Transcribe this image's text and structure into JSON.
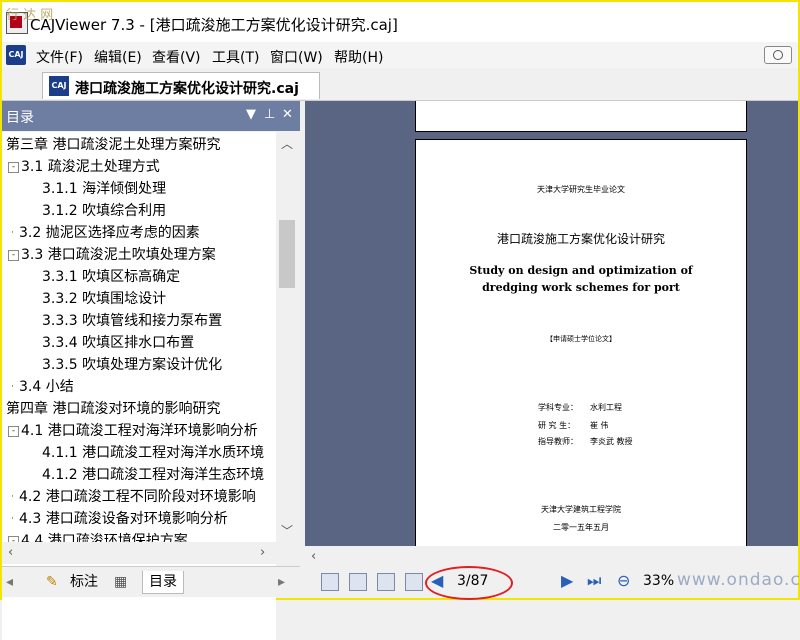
{
  "window": {
    "title": "CAJViewer 7.3 - [港口疏浚施工方案优化设计研究.caj]",
    "watermark": "行 达 网"
  },
  "menu": [
    "文件(F)",
    "编辑(E)",
    "查看(V)",
    "工具(T)",
    "窗口(W)",
    "帮助(H)"
  ],
  "doc_tab": {
    "label": "港口疏浚施工方案优化设计研究.caj"
  },
  "toc": {
    "header": "目录",
    "items": [
      {
        "label": "第三章 港口疏浚泥土处理方案研究",
        "level": 0,
        "box": ""
      },
      {
        "label": "3.1 疏浚泥土处理方式",
        "level": 1,
        "box": "-"
      },
      {
        "label": "3.1.1 海洋倾倒处理",
        "level": 2,
        "box": ""
      },
      {
        "label": "3.1.2 吹填综合利用",
        "level": 2,
        "box": ""
      },
      {
        "label": "3.2 抛泥区选择应考虑的因素",
        "level": 1,
        "box": ""
      },
      {
        "label": "3.3 港口疏浚泥土吹填处理方案",
        "level": 1,
        "box": "-"
      },
      {
        "label": "3.3.1 吹填区标高确定",
        "level": 2,
        "box": ""
      },
      {
        "label": "3.3.2 吹填围埝设计",
        "level": 2,
        "box": ""
      },
      {
        "label": "3.3.3 吹填管线和接力泵布置",
        "level": 2,
        "box": ""
      },
      {
        "label": "3.3.4 吹填区排水口布置",
        "level": 2,
        "box": ""
      },
      {
        "label": "3.3.5 吹填处理方案设计优化",
        "level": 2,
        "box": ""
      },
      {
        "label": "3.4 小结",
        "level": 1,
        "box": ""
      },
      {
        "label": "第四章 港口疏浚对环境的影响研究",
        "level": 0,
        "box": ""
      },
      {
        "label": "4.1 港口疏浚工程对海洋环境影响分析",
        "level": 1,
        "box": "-"
      },
      {
        "label": "4.1.1 港口疏浚工程对海洋水质环境",
        "level": 2,
        "box": ""
      },
      {
        "label": "4.1.2 港口疏浚工程对海洋生态环境",
        "level": 2,
        "box": ""
      },
      {
        "label": "4.2 港口疏浚工程不同阶段对环境影响",
        "level": 1,
        "box": ""
      },
      {
        "label": "4.3 港口疏浚设备对环境影响分析",
        "level": 1,
        "box": ""
      },
      {
        "label": "4.4 港口疏浚环境保护方案",
        "level": 1,
        "box": "-"
      }
    ]
  },
  "pane_tabs": [
    "标注",
    "目录"
  ],
  "page": {
    "university_header": "天津大学研究生毕业论文",
    "title_cn": "港口疏浚施工方案优化设计研究",
    "title_en_1": "Study on design and optimization of",
    "title_en_2": "dredging work schemes for port",
    "degree": "【申请硕士学位论文】",
    "major_label": "学科专业：",
    "major_value": "水利工程",
    "student_label": "研 究 生：",
    "student_value": "崔 伟",
    "advisor_label": "指导教师：",
    "advisor_value": "李炎武 教授",
    "school": "天津大学建筑工程学院",
    "date": "二零一五年五月"
  },
  "status": {
    "page_indicator": "3/87",
    "zoom": "33%",
    "watermark": "www.ondao.com"
  }
}
